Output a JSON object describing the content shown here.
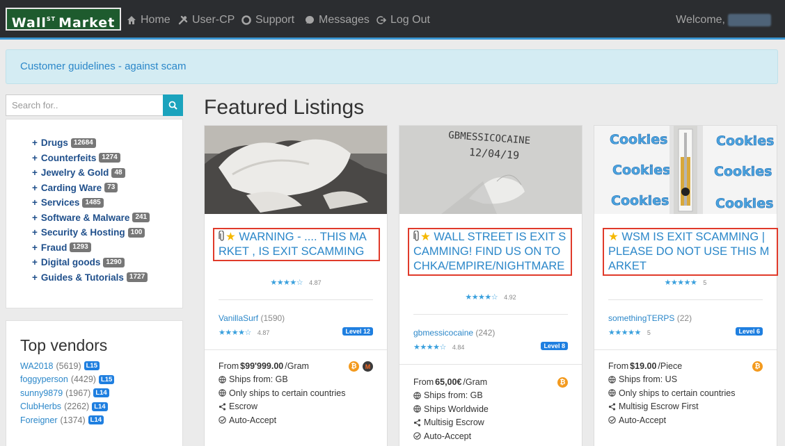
{
  "nav": {
    "brand": "Wall",
    "brand_sup": "ST",
    "brand_tail": "Market",
    "items": [
      {
        "label": "Home",
        "icon": "home-icon"
      },
      {
        "label": "User-CP",
        "icon": "tools-icon"
      },
      {
        "label": "Support",
        "icon": "lifebuoy-icon"
      },
      {
        "label": "Messages",
        "icon": "chat-bubble-icon"
      },
      {
        "label": "Log Out",
        "icon": "logout-icon"
      }
    ],
    "welcome": "Welcome,"
  },
  "alert": {
    "text": "Customer guidelines - against scam"
  },
  "search": {
    "placeholder": "Search for.."
  },
  "categories": [
    {
      "label": "Drugs",
      "count": "12684"
    },
    {
      "label": "Counterfeits",
      "count": "1274"
    },
    {
      "label": "Jewelry & Gold",
      "count": "48"
    },
    {
      "label": "Carding Ware",
      "count": "73"
    },
    {
      "label": "Services",
      "count": "1485"
    },
    {
      "label": "Software & Malware",
      "count": "241"
    },
    {
      "label": "Security & Hosting",
      "count": "100"
    },
    {
      "label": "Fraud",
      "count": "1293"
    },
    {
      "label": "Digital goods",
      "count": "1290"
    },
    {
      "label": "Guides & Tutorials",
      "count": "1727"
    }
  ],
  "vendors": {
    "title": "Top vendors",
    "items": [
      {
        "name": "WA2018",
        "count": "(5619)",
        "level": "L15"
      },
      {
        "name": "foggyperson",
        "count": "(4429)",
        "level": "L15"
      },
      {
        "name": "sunny9879",
        "count": "(1967)",
        "level": "L14"
      },
      {
        "name": "ClubHerbs",
        "count": "(2262)",
        "level": "L14"
      },
      {
        "name": "Foreigner",
        "count": "(1374)",
        "level": "L14"
      }
    ]
  },
  "featured": {
    "title": "Featured Listings",
    "cards": [
      {
        "title": "WARNING - .... THIS MARKET , IS EXIT SCAMMING",
        "stars": "★★★★☆",
        "rating": "4.87",
        "vendor": "VanillaSurf",
        "vendor_count": "(1590)",
        "vendor_stars": "★★★★☆",
        "vendor_rating": "4.87",
        "level": "Level 12",
        "price_prefix": "From",
        "price": "$99'999.00",
        "unit": "/Gram",
        "ships_from": "Ships from: GB",
        "ships_to": "Only ships to certain countries",
        "escrow": "Escrow",
        "accept": "Auto-Accept"
      },
      {
        "title": "WALL STREET IS EXIT SCAMMING! FIND US ON TOCHKA/EMPIRE/NIGHTMARE",
        "stars": "★★★★☆",
        "rating": "4.92",
        "vendor": "gbmessicocaine",
        "vendor_count": "(242)",
        "vendor_stars": "★★★★☆",
        "vendor_rating": "4.84",
        "level": "Level 8",
        "price_prefix": "From",
        "price": "65,00€",
        "unit": "/Gram",
        "ships_from": "Ships from: GB",
        "ships_to": "Ships Worldwide",
        "escrow": "Multisig Escrow",
        "accept": "Auto-Accept",
        "thumb_text_1": "GBMESSICOCAINE",
        "thumb_text_2": "12/04/19"
      },
      {
        "title": "WSM IS EXIT SCAMMING | PLEASE DO NOT USE THIS MARKET",
        "stars": "★★★★★",
        "rating": "5",
        "vendor": "somethingTERPS",
        "vendor_count": "(22)",
        "vendor_stars": "★★★★★",
        "vendor_rating": "5",
        "level": "Level 6",
        "price_prefix": "From",
        "price": "$19.00",
        "unit": "/Piece",
        "ships_from": "Ships from: US",
        "ships_to": "Only ships to certain countries",
        "escrow": "Multisig Escrow First",
        "accept": "Auto-Accept",
        "thumb_word": "Cookies"
      }
    ]
  },
  "colors": {
    "brand_green": "#1e5b2e",
    "link_blue": "#2b87c9",
    "highlight_red": "#e03a2a",
    "level_blue": "#1f7fe0"
  }
}
